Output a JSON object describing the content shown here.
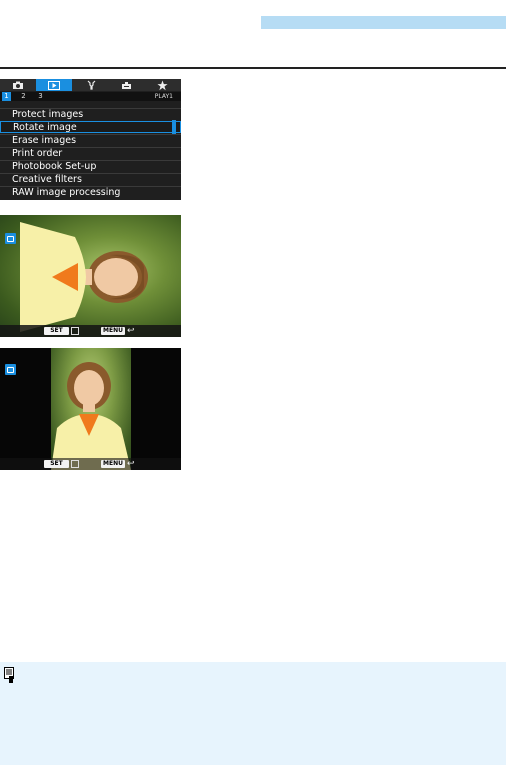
{
  "menu": {
    "tabs": [
      {
        "icon": "camera-icon"
      },
      {
        "icon": "playback-icon",
        "active": true
      },
      {
        "icon": "wrench-icon"
      },
      {
        "icon": "custom-functions-icon"
      },
      {
        "icon": "star-icon"
      }
    ],
    "pages": [
      "1",
      "2",
      "3"
    ],
    "active_page": "1",
    "tab_label": "PLAY1",
    "items": [
      {
        "label": "Protect images"
      },
      {
        "label": "Rotate image",
        "selected": true
      },
      {
        "label": "Erase images"
      },
      {
        "label": "Print order"
      },
      {
        "label": "Photobook Set-up"
      },
      {
        "label": "Creative filters"
      },
      {
        "label": "RAW image processing"
      }
    ]
  },
  "screens": {
    "set_label": "SET",
    "menu_label": "MENU"
  },
  "colors": {
    "accent": "#1a8fe0",
    "header_bar": "#b6dcf4",
    "note_bg": "#e7f4fd"
  }
}
